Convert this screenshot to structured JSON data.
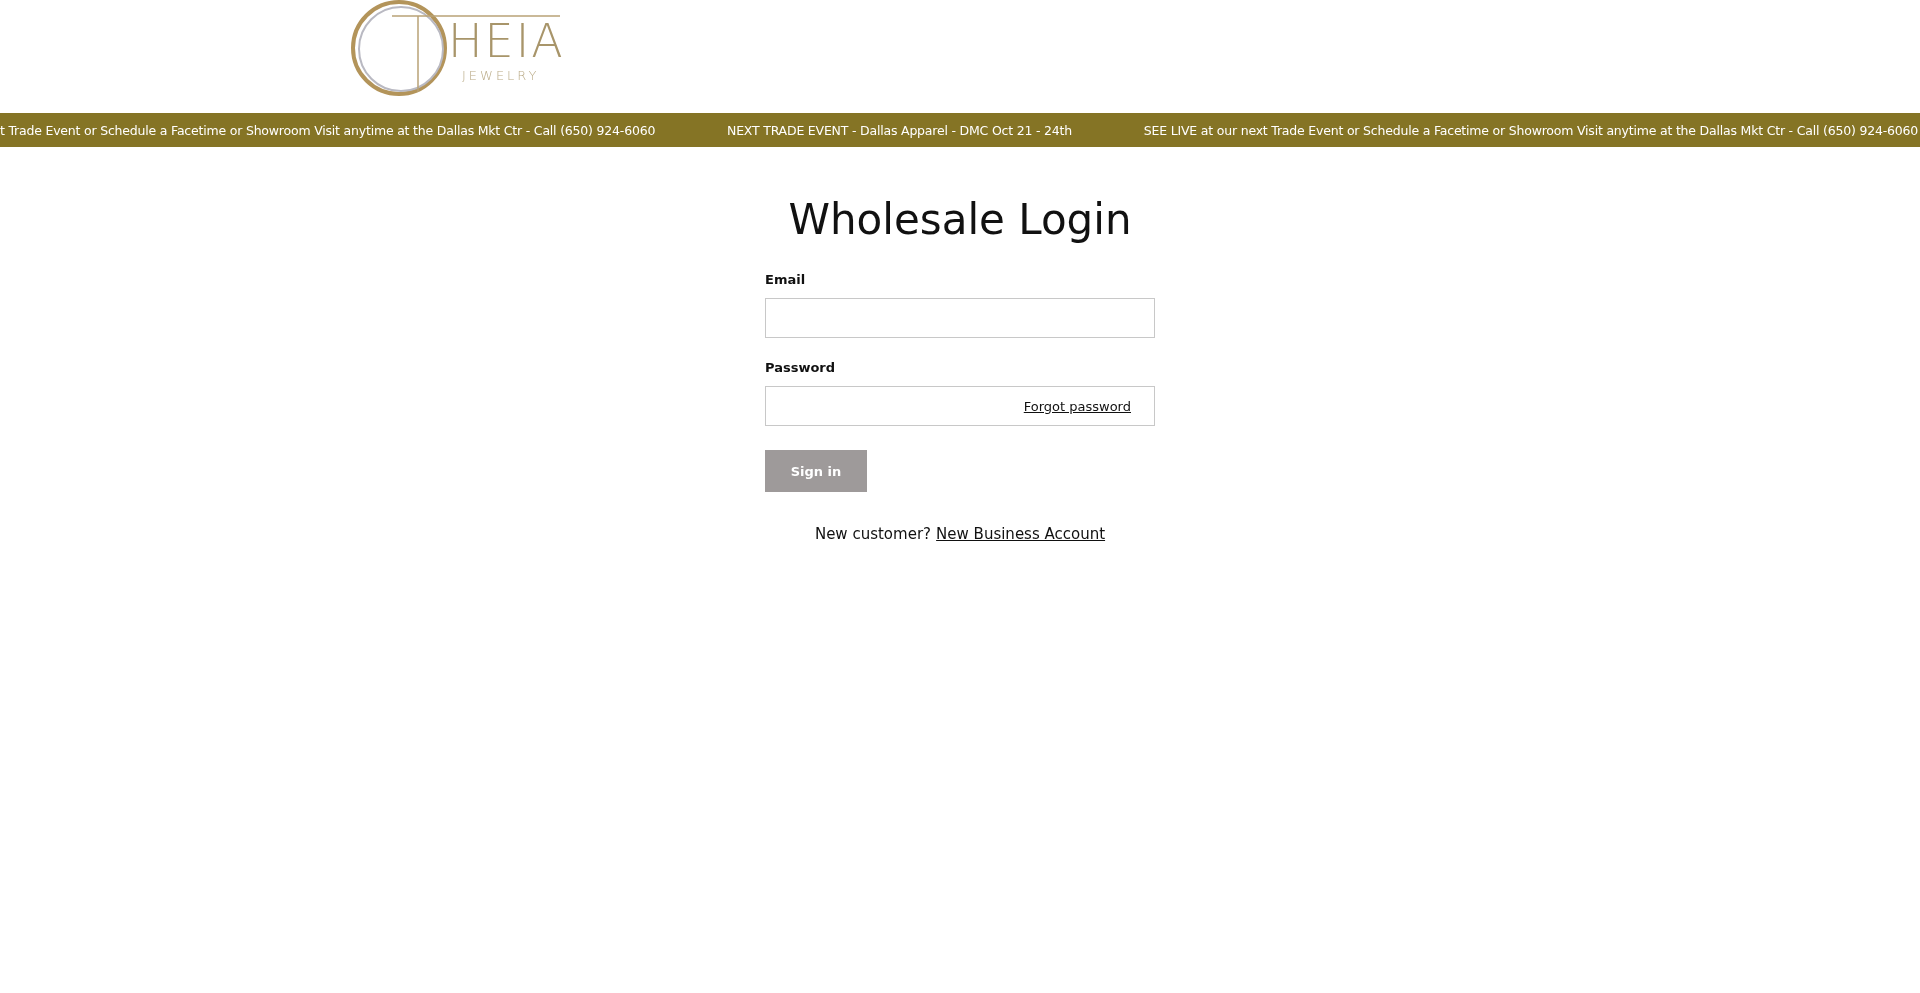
{
  "logo": {
    "letters": "HEIA",
    "tagline": "JEWELRY"
  },
  "announcements": [
    "t Trade Event or Schedule a Facetime or Showroom Visit anytime at the Dallas Mkt Ctr - Call (650) 924-6060",
    "NEXT TRADE EVENT - Dallas Apparel - DMC Oct 21 - 24th",
    "SEE LIVE at our next Trade Event or Schedule a Facetime or Showroom Visit anytime at the Dallas Mkt Ctr - Call (650) 924-6060"
  ],
  "title": "Wholesale Login",
  "fields": [
    {
      "label": "Email"
    },
    {
      "label": "Password",
      "link": "Forgot password"
    }
  ],
  "submit": {
    "label": "Sign in",
    "disabled": true
  },
  "footer": {
    "text": "New customer?",
    "link": "New Business Account"
  }
}
